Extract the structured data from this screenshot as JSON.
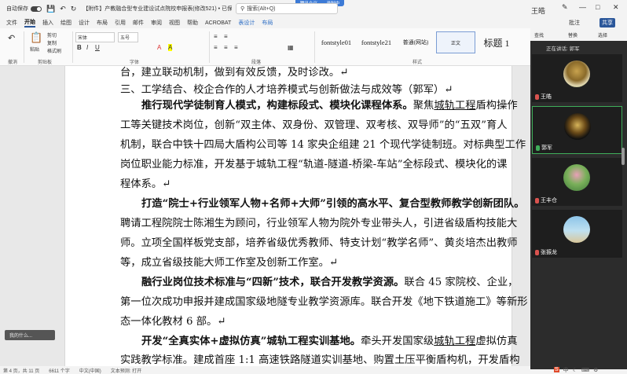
{
  "titlebar": {
    "autosave": "自动保存",
    "title": "【附件】产教融合型专业建设试点院校申报表(修改521) • 已保存到这台电脑",
    "search": "搜索(Alt+Q)",
    "user": "王皓",
    "meet_label": "腾讯会议",
    "meet_action": "录制中"
  },
  "menu": {
    "items": [
      "文件",
      "开始",
      "插入",
      "绘图",
      "设计",
      "布局",
      "引用",
      "邮件",
      "审阅",
      "视图",
      "帮助",
      "ACROBAT",
      "表设计",
      "布局"
    ],
    "right_items": [
      "批注",
      "共享"
    ]
  },
  "ribbon": {
    "groups": [
      "撤消",
      "剪贴板",
      "字体",
      "段落",
      "样式",
      "编辑"
    ],
    "paste": "粘贴",
    "cut": "剪切",
    "copy": "复制",
    "format_painter": "格式刷",
    "font": "宋体",
    "font_size": "五号",
    "styles": [
      "fontstyle01",
      "fontstyle21",
      "普通(网站)",
      "正文",
      "标题 1"
    ],
    "find": "查找",
    "replace": "替换",
    "select": "选择"
  },
  "participants": {
    "header": "正在讲话: 郭军",
    "people": [
      {
        "name": "王皓",
        "mic": "off"
      },
      {
        "name": "郭军",
        "mic": "on"
      },
      {
        "name": "王丰仓",
        "mic": "off"
      },
      {
        "name": "张振龙",
        "mic": "off"
      }
    ]
  },
  "document": {
    "lines": [
      "台，建立联动机制，做到有效反馈，及时诊改。↵",
      "三、工学结合、校企合作的人才培养模式与创新做法与成效等（郭军）↵",
      "推行现代学徒制育人模式，构建标段式、模块化课程体系。聚焦城轨工程盾构操作",
      "工等关键技术岗位，创新“双主体、双身份、双管理、双考核、双导师”的“五双”育人",
      "机制，联合中铁十四局大盾构公司等 14 家央企组建 21 个现代学徒制班。对标典型工作",
      "岗位职业能力标准，开发基于城轨工程“轨道-隧道-桥梁-车站”全标段式、模块化的课",
      "程体系。↵",
      "打造“院士+行业领军人物+名师+大师”引领的高水平、复合型教师教学创新团队。",
      "聘请工程院院士陈湘生为顾问，行业领军人物为院外专业带头人，引进省级盾构技能大",
      "师。立项全国样板党支部，培养省级优秀教师、特支计划“教学名师”、黄炎培杰出教师",
      "等，成立省级技能大师工作室及创新工作室。↵",
      "融行业岗位技术标准与“四新”技术，联合开发教学资源。联合 45 家院校、企业，",
      "第一位次成功申报并建成国家级地隧专业教学资源库。联合开发《地下铁道施工》等新形",
      "态一体化教材 6 部。↵",
      "开发“全真实体+虚拟仿真”城轨工程实训基地。牵头开发国家级城轨工程虚拟仿真",
      "实践教学标准。建成首座 1:1 高速铁路隧道实训基地、购置土压平衡盾构机，开发盾构"
    ]
  },
  "statusbar": {
    "text": "第 4 页，共 11 页　　6611 个字　　中文(中国)　　文本预测: 打开"
  },
  "floating": {
    "label": "我的什么..."
  },
  "colors": {
    "accent": "#2b579a",
    "meeting": "#3c7ad6",
    "active_speaker": "#3fae5a"
  }
}
